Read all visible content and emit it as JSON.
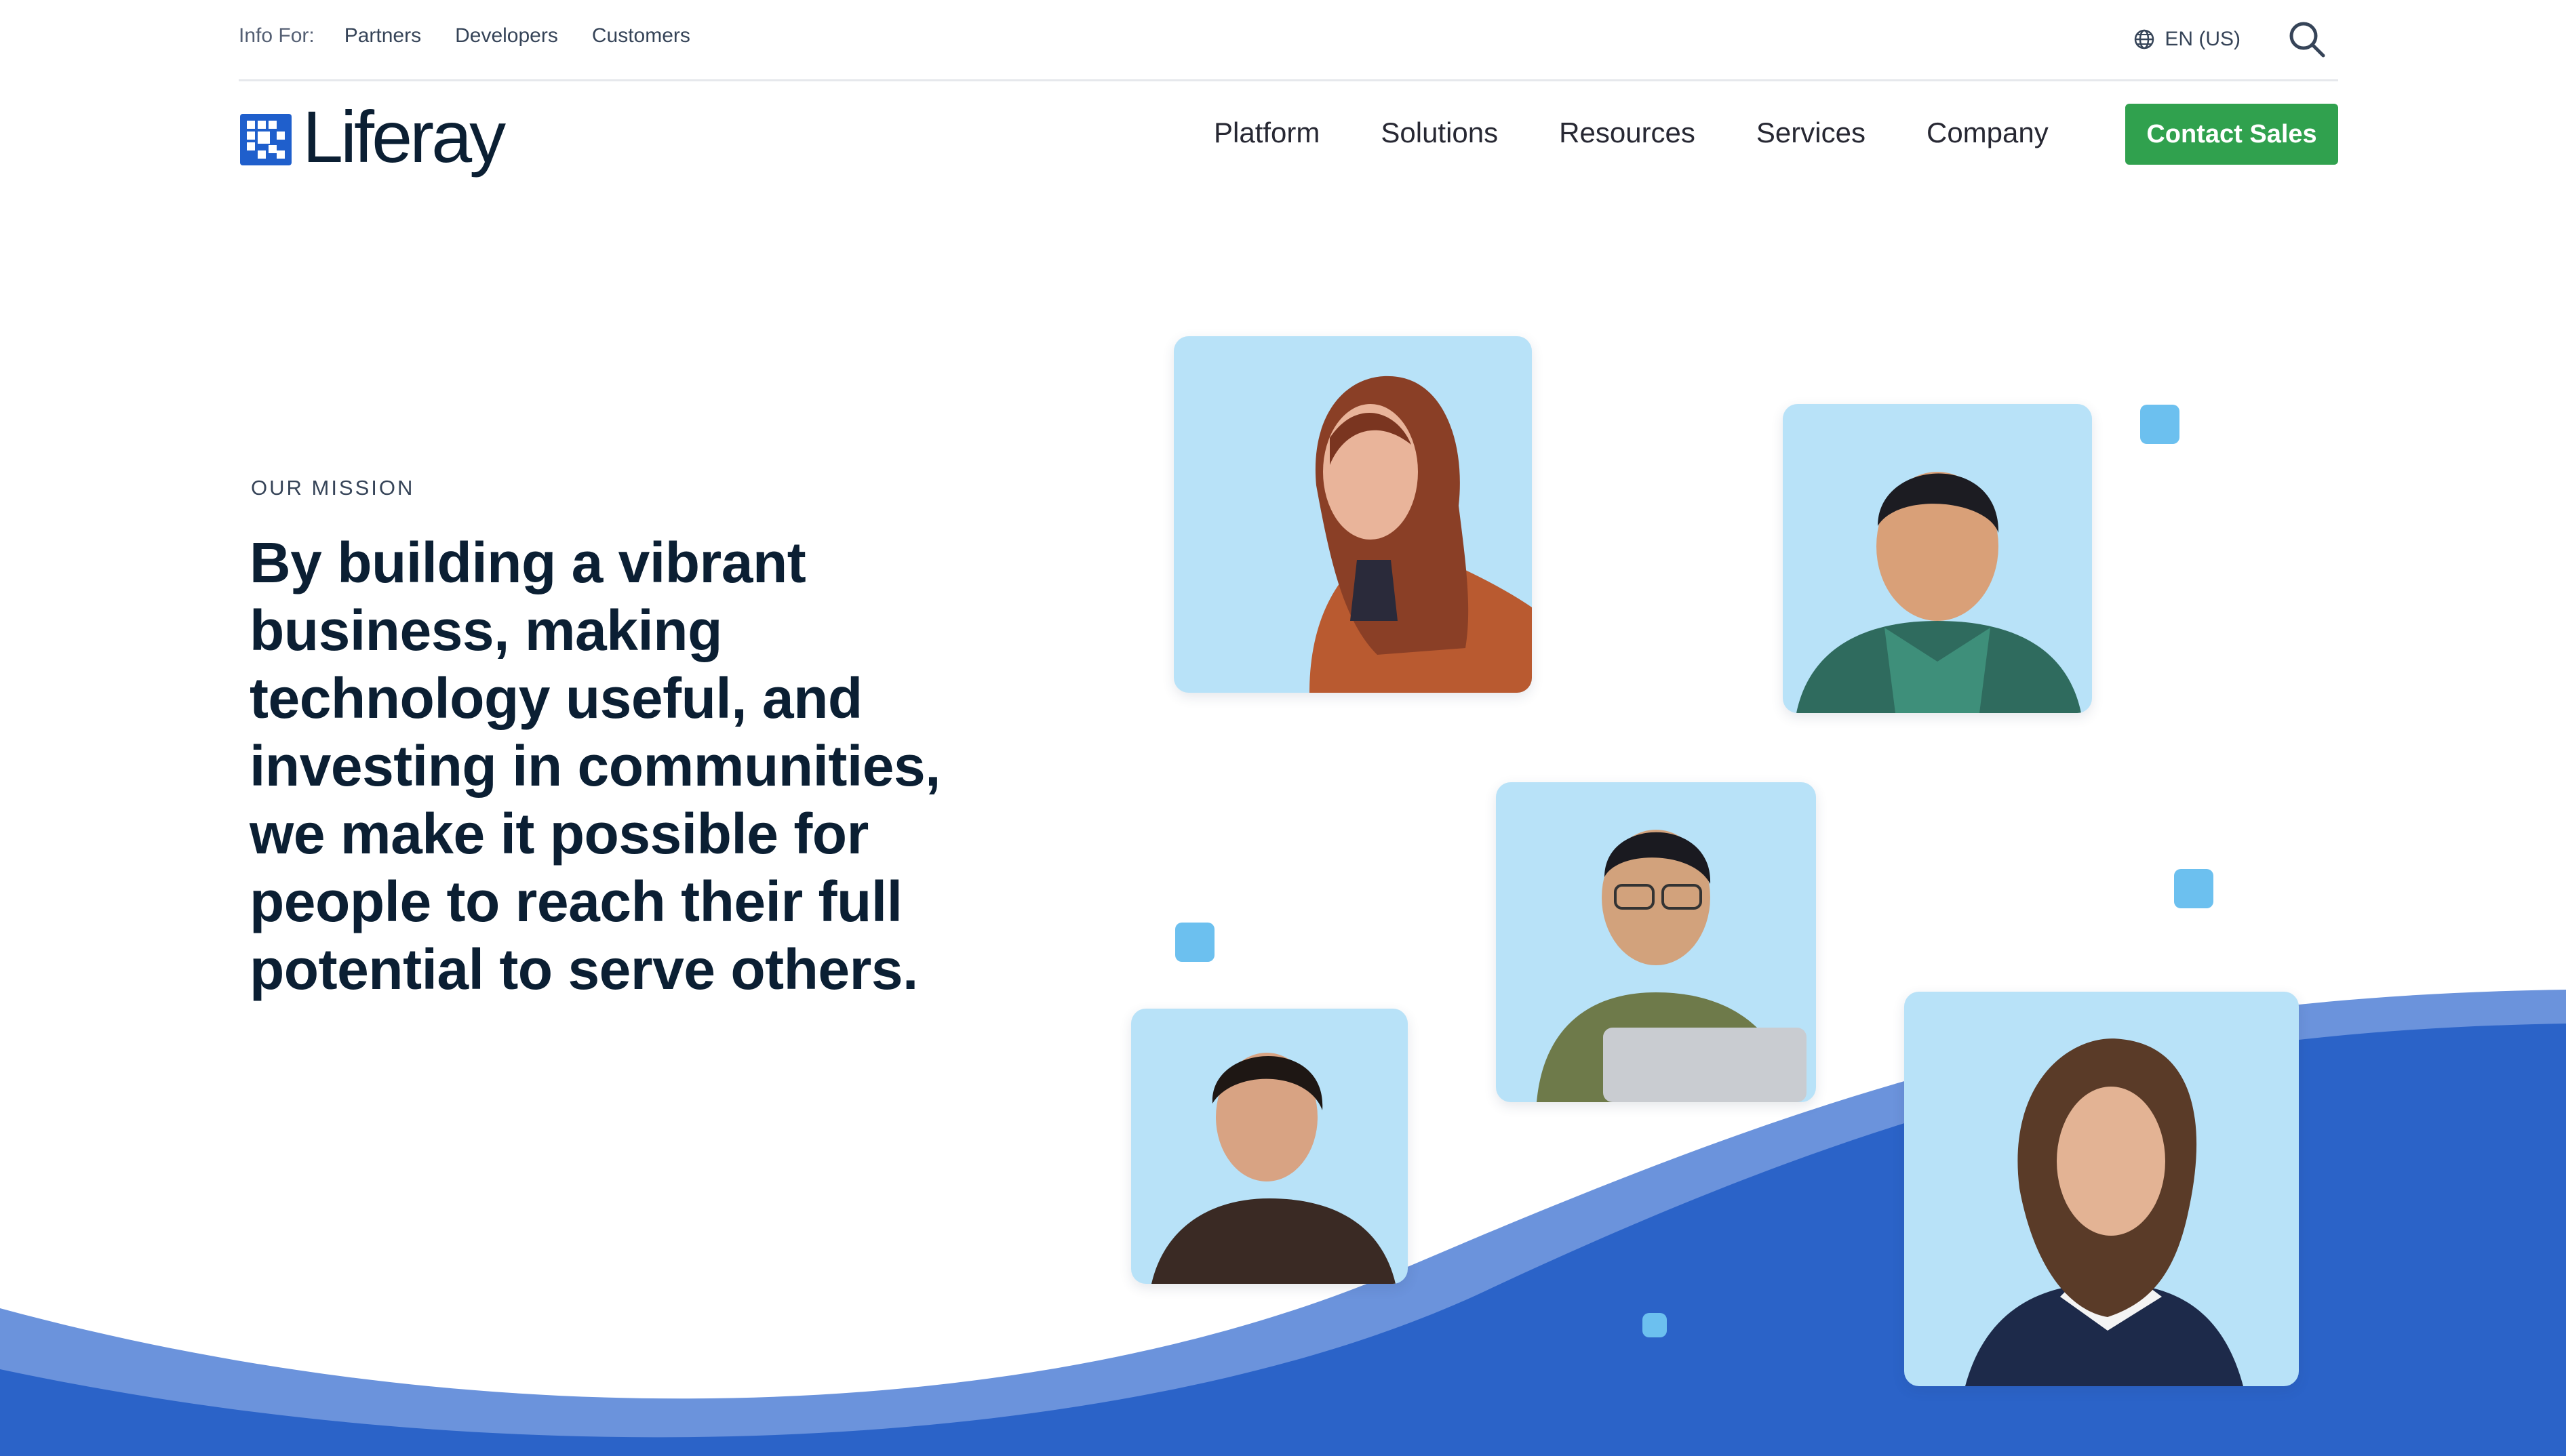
{
  "utility_bar": {
    "info_label": "Info For:",
    "links": [
      "Partners",
      "Developers",
      "Customers"
    ],
    "language": "EN (US)"
  },
  "header": {
    "logo_text": "Liferay",
    "nav": [
      "Platform",
      "Solutions",
      "Resources",
      "Services",
      "Company"
    ],
    "cta_label": "Contact Sales"
  },
  "hero": {
    "eyebrow": "OUR MISSION",
    "headline": "By building a vibrant business, making technology useful, and investing in communities, we make it possible for people to reach their full potential to serve others."
  },
  "colors": {
    "brand_blue": "#1f5fcc",
    "wave_dark": "#2b63c8",
    "wave_light": "#6b93dc",
    "cta_green": "#30a14e",
    "card_bg": "#b8e2f8",
    "accent_square": "#6cc0ef"
  },
  "icons": [
    "globe-icon",
    "search-icon",
    "liferay-logo-icon"
  ]
}
